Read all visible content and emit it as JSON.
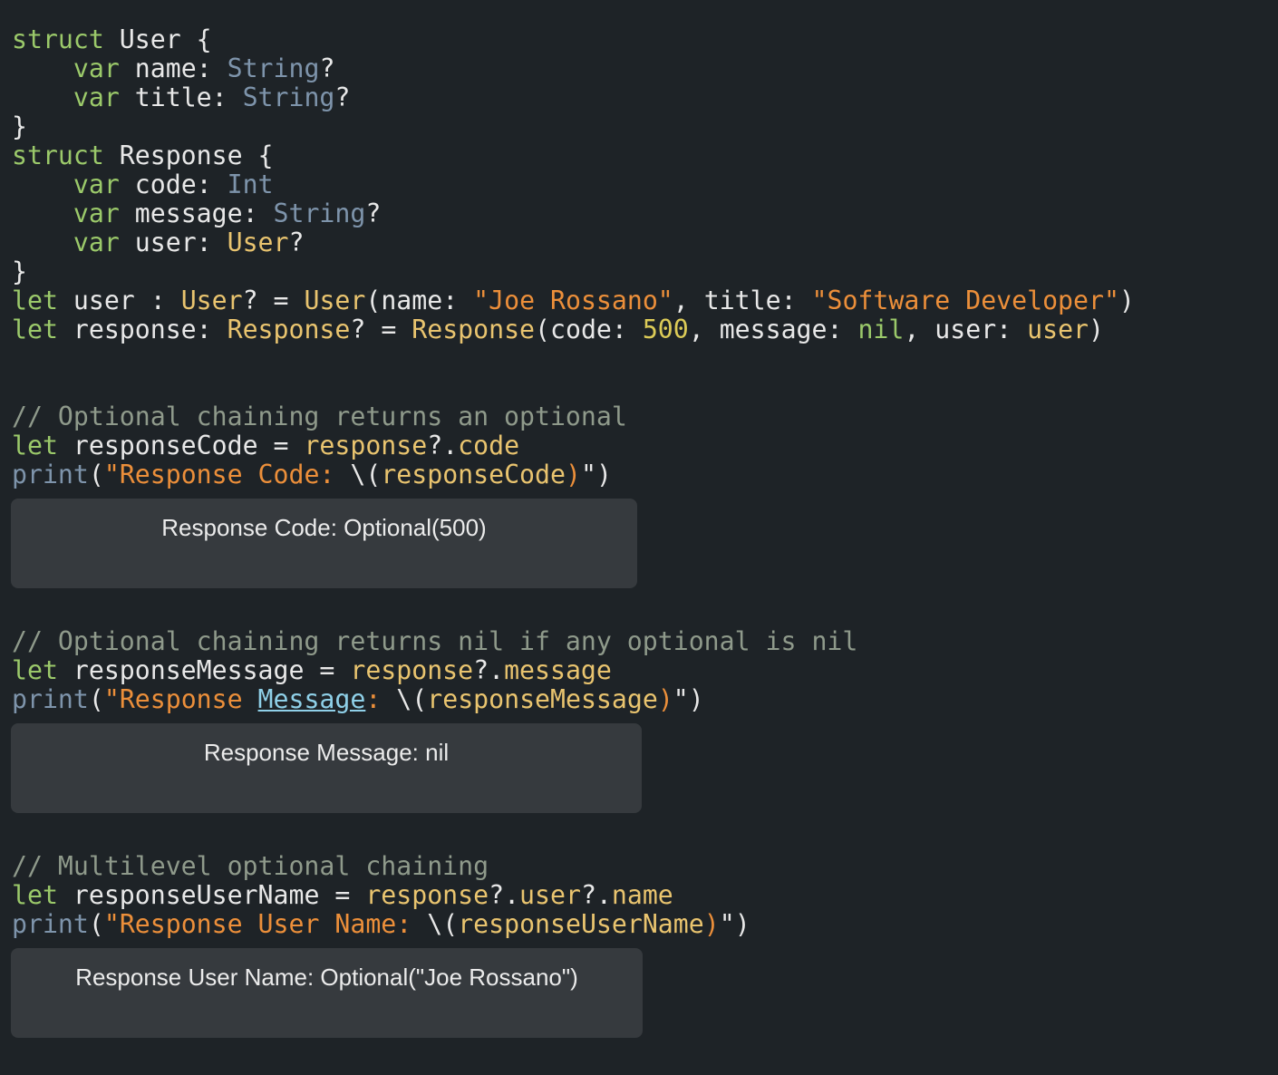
{
  "colors": {
    "background": "#1e2327",
    "keyword": "#9bc96a",
    "plain": "#e8e8e8",
    "type": "#7e94ab",
    "user_type": "#e9c46f",
    "string": "#ec8f3a",
    "number": "#dccb57",
    "comment": "#8f9a8b",
    "link": "#8fd0e8",
    "result_background": "#363a3e",
    "result_text": "#ebebeb"
  },
  "code_lines": [
    [
      {
        "t": "struct",
        "c": "keyword"
      },
      {
        "t": " User {",
        "c": "plain"
      }
    ],
    [
      {
        "t": "    ",
        "c": "plain"
      },
      {
        "t": "var",
        "c": "keyword"
      },
      {
        "t": " name: ",
        "c": "plain"
      },
      {
        "t": "String",
        "c": "type"
      },
      {
        "t": "?",
        "c": "plain"
      }
    ],
    [
      {
        "t": "    ",
        "c": "plain"
      },
      {
        "t": "var",
        "c": "keyword"
      },
      {
        "t": " title: ",
        "c": "plain"
      },
      {
        "t": "String",
        "c": "type"
      },
      {
        "t": "?",
        "c": "plain"
      }
    ],
    [
      {
        "t": "}",
        "c": "plain"
      }
    ],
    [
      {
        "t": "struct",
        "c": "keyword"
      },
      {
        "t": " Response {",
        "c": "plain"
      }
    ],
    [
      {
        "t": "    ",
        "c": "plain"
      },
      {
        "t": "var",
        "c": "keyword"
      },
      {
        "t": " code: ",
        "c": "plain"
      },
      {
        "t": "Int",
        "c": "type"
      }
    ],
    [
      {
        "t": "    ",
        "c": "plain"
      },
      {
        "t": "var",
        "c": "keyword"
      },
      {
        "t": " message: ",
        "c": "plain"
      },
      {
        "t": "String",
        "c": "type"
      },
      {
        "t": "?",
        "c": "plain"
      }
    ],
    [
      {
        "t": "    ",
        "c": "plain"
      },
      {
        "t": "var",
        "c": "keyword"
      },
      {
        "t": " user: ",
        "c": "plain"
      },
      {
        "t": "User",
        "c": "user_type"
      },
      {
        "t": "?",
        "c": "plain"
      }
    ],
    [
      {
        "t": "}",
        "c": "plain"
      }
    ],
    [
      {
        "t": "let",
        "c": "keyword"
      },
      {
        "t": " user : ",
        "c": "plain"
      },
      {
        "t": "User",
        "c": "user_type"
      },
      {
        "t": "? = ",
        "c": "plain"
      },
      {
        "t": "User",
        "c": "user_type"
      },
      {
        "t": "(name: ",
        "c": "plain"
      },
      {
        "t": "\"Joe Rossano\"",
        "c": "string"
      },
      {
        "t": ", title: ",
        "c": "plain"
      },
      {
        "t": "\"Software Developer\"",
        "c": "string"
      },
      {
        "t": ")",
        "c": "plain"
      }
    ],
    [
      {
        "t": "let",
        "c": "keyword"
      },
      {
        "t": " response: ",
        "c": "plain"
      },
      {
        "t": "Response",
        "c": "user_type"
      },
      {
        "t": "? = ",
        "c": "plain"
      },
      {
        "t": "Response",
        "c": "user_type"
      },
      {
        "t": "(code: ",
        "c": "plain"
      },
      {
        "t": "500",
        "c": "number"
      },
      {
        "t": ", message: ",
        "c": "plain"
      },
      {
        "t": "nil",
        "c": "keyword"
      },
      {
        "t": ", user: ",
        "c": "plain"
      },
      {
        "t": "user",
        "c": "user_type"
      },
      {
        "t": ")",
        "c": "plain"
      }
    ],
    [],
    [],
    [
      {
        "t": "// Optional chaining returns an optional",
        "c": "comment"
      }
    ],
    [
      {
        "t": "let",
        "c": "keyword"
      },
      {
        "t": " responseCode = ",
        "c": "plain"
      },
      {
        "t": "response",
        "c": "user_type"
      },
      {
        "t": "?.",
        "c": "plain"
      },
      {
        "t": "code",
        "c": "user_type"
      }
    ],
    [
      {
        "t": "print",
        "c": "type"
      },
      {
        "t": "(",
        "c": "plain"
      },
      {
        "t": "\"Response Code: ",
        "c": "string"
      },
      {
        "t": "\\(",
        "c": "plain"
      },
      {
        "t": "responseCode",
        "c": "user_type"
      },
      {
        "t": ")",
        "c": "string"
      },
      {
        "t": "\"",
        "c": "plain"
      },
      {
        "t": ")",
        "c": "plain"
      }
    ],
    [
      {
        "t": "// Optional chaining returns nil if any optional is nil",
        "c": "comment"
      }
    ],
    [
      {
        "t": "let",
        "c": "keyword"
      },
      {
        "t": " responseMessage = ",
        "c": "plain"
      },
      {
        "t": "response",
        "c": "user_type"
      },
      {
        "t": "?.",
        "c": "plain"
      },
      {
        "t": "message",
        "c": "user_type"
      }
    ],
    [
      {
        "t": "print",
        "c": "type"
      },
      {
        "t": "(",
        "c": "plain"
      },
      {
        "t": "\"Response ",
        "c": "string"
      },
      {
        "t": "Message",
        "c": "link"
      },
      {
        "t": ": ",
        "c": "string"
      },
      {
        "t": "\\(",
        "c": "plain"
      },
      {
        "t": "responseMessage",
        "c": "user_type"
      },
      {
        "t": ")",
        "c": "string"
      },
      {
        "t": "\"",
        "c": "plain"
      },
      {
        "t": ")",
        "c": "plain"
      }
    ],
    [
      {
        "t": "// Multilevel optional chaining",
        "c": "comment"
      }
    ],
    [
      {
        "t": "let",
        "c": "keyword"
      },
      {
        "t": " responseUserName = ",
        "c": "plain"
      },
      {
        "t": "response",
        "c": "user_type"
      },
      {
        "t": "?.",
        "c": "plain"
      },
      {
        "t": "user",
        "c": "user_type"
      },
      {
        "t": "?.",
        "c": "plain"
      },
      {
        "t": "name",
        "c": "user_type"
      }
    ],
    [
      {
        "t": "print",
        "c": "type"
      },
      {
        "t": "(",
        "c": "plain"
      },
      {
        "t": "\"Response User Name: ",
        "c": "string"
      },
      {
        "t": "\\(",
        "c": "plain"
      },
      {
        "t": "responseUserName",
        "c": "user_type"
      },
      {
        "t": ")",
        "c": "string"
      },
      {
        "t": "\"",
        "c": "plain"
      },
      {
        "t": ")",
        "c": "plain"
      }
    ]
  ],
  "results": [
    {
      "text": "Response Code: Optional(500)"
    },
    {
      "text": "Response Message: nil"
    },
    {
      "text": "Response User Name: Optional(\"Joe Rossano\")"
    }
  ]
}
